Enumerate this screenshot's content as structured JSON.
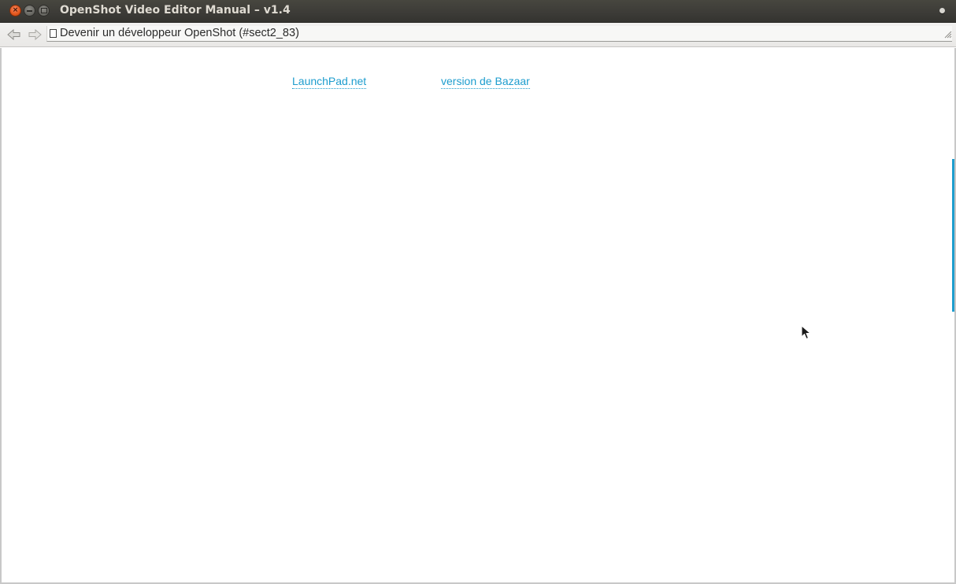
{
  "window": {
    "title": "OpenShot Video Editor Manual – v1.4",
    "close_glyph": "×"
  },
  "toolbar": {
    "url": "Devenir un développeur OpenShot (#sect2_83)",
    "back_icon": "arrow-left-icon",
    "forward_icon": "arrow-right-icon",
    "bookmark_icon": "star-icon"
  },
  "content": {
    "links": [
      {
        "label": "LaunchPad.net"
      },
      {
        "label": "version de Bazaar"
      }
    ]
  },
  "colors": {
    "link": "#1e9dce",
    "titlebar": "#3c3b37",
    "close_button": "#e1561c",
    "scroll_indicator": "#1e9dce"
  }
}
